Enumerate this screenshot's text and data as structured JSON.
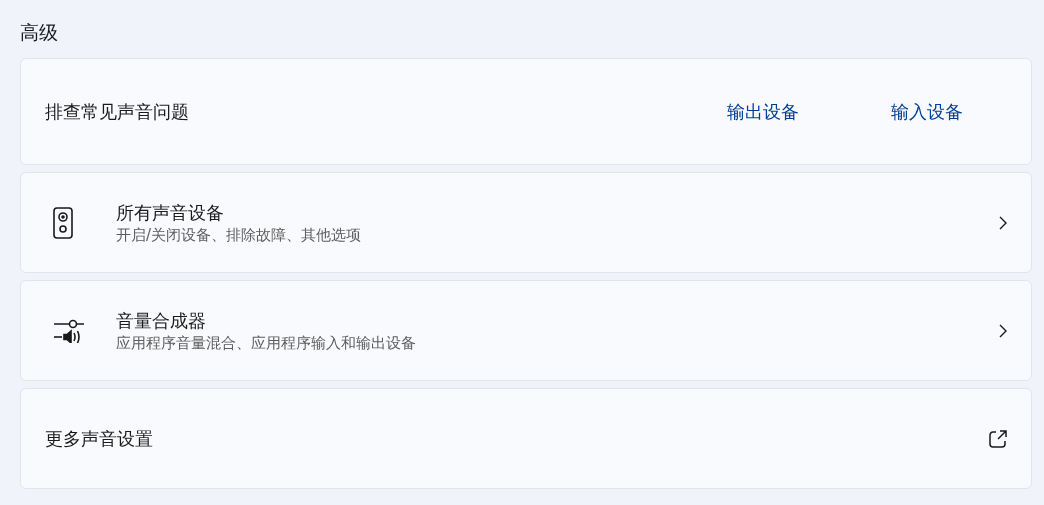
{
  "section_title": "高级",
  "rows": [
    {
      "kind": "links",
      "title": "排查常见声音问题",
      "links": [
        "输出设备",
        "输入设备"
      ]
    },
    {
      "kind": "speaker",
      "title": "所有声音设备",
      "subtitle": "开启/关闭设备、排除故障、其他选项"
    },
    {
      "kind": "mixer",
      "title": "音量合成器",
      "subtitle": "应用程序音量混合、应用程序输入和输出设备"
    },
    {
      "kind": "external",
      "title": "更多声音设置"
    }
  ]
}
